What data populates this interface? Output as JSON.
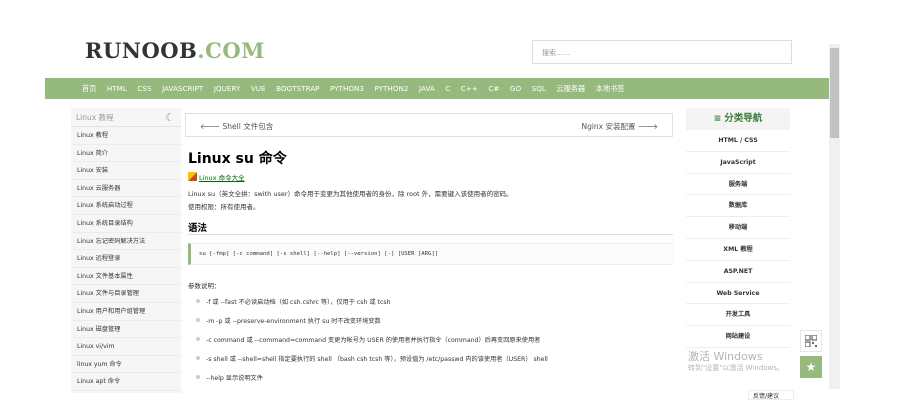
{
  "header": {
    "logo_main": "RUNOOB",
    "logo_dot": ".COM",
    "search_placeholder": "搜索……"
  },
  "nav": [
    "首页",
    "HTML",
    "CSS",
    "JAVASCRIPT",
    "JQUERY",
    "VUE",
    "BOOTSTRAP",
    "PYTHON3",
    "PYTHON2",
    "JAVA",
    "C",
    "C++",
    "C#",
    "GO",
    "SQL",
    "云服务器",
    "本地书签"
  ],
  "left_sidebar": {
    "title": "Linux 教程",
    "moon_icon": "☾",
    "items": [
      "Linux 教程",
      "Linux 简介",
      "Linux 安装",
      "Linux 云服务器",
      "Linux 系统启动过程",
      "Linux 系统目录结构",
      "Linux 忘记密码解决方法",
      "Linux 远程登录",
      "Linux 文件基本属性",
      "Linux 文件与目录管理",
      "Linux 用户和用户组管理",
      "Linux 磁盘管理",
      "Linux vi/vim",
      "linux yum 命令",
      "Linux apt 命令"
    ]
  },
  "main": {
    "prev": "Shell 文件包含",
    "prev_arrow": "🡐",
    "next": "Nginx 安装配置",
    "next_arrow": "🡒",
    "title": "Linux su 命令",
    "cmd_link": "Linux 命令大全",
    "intro": "Linux su（英文全拼：swith user）命令用于变更为其他使用者的身份，除 root 外，需要键入该使用者的密码。",
    "permission": "使用权限：所有使用者。",
    "syntax_heading": "语法",
    "syntax_code": "su [-fmp] [-c command] [-s shell] [--help] [--version] [-] [USER [ARG]]",
    "params_heading": "参数说明：",
    "params": [
      "-f 或 --fast 不必读启动档（如 csh.cshrc 等），仅用于 csh 或 tcsh",
      "-m -p 或 --preserve-environment 执行 su 时不改变环境变数",
      "-c command 或 --command=command 变更为帐号为 USER 的使用者并执行指令（command）后再变回原来使用者",
      "-s shell 或 --shell=shell 指定要执行的 shell （bash csh tcsh 等），预设值为 /etc/passwd 内的该使用者（USER） shell",
      "--help 显示说明文件"
    ]
  },
  "right_sidebar": {
    "title": "分类导航",
    "title_icon": "≡",
    "items": [
      "HTML / CSS",
      "JavaScript",
      "服务端",
      "数据库",
      "移动端",
      "XML 教程",
      "ASP.NET",
      "Web Service",
      "开发工具",
      "网站建设"
    ]
  },
  "watermark": {
    "line1": "激活 Windows",
    "line2": "转到\"设置\"以激活 Windows。"
  },
  "partial_button": "反馈/建议",
  "float_buttons": {
    "qr_icon": "qr-code-icon",
    "star": "★"
  },
  "colors": {
    "accent": "#96b97d",
    "link_green": "#006600"
  }
}
